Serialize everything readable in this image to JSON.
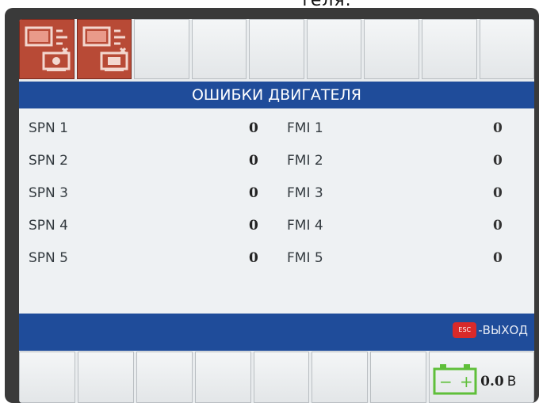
{
  "top_fragment": "теля.",
  "title": "ОШИБКИ ДВИГАТЕЛЯ",
  "rows": [
    {
      "spn_label": "SPN 1",
      "spn_value": "0",
      "fmi_label": "FMI 1",
      "fmi_value": "0"
    },
    {
      "spn_label": "SPN 2",
      "spn_value": "0",
      "fmi_label": "FMI 2",
      "fmi_value": "0"
    },
    {
      "spn_label": "SPN 3",
      "spn_value": "0",
      "fmi_label": "FMI 3",
      "fmi_value": "0"
    },
    {
      "spn_label": "SPN 4",
      "spn_value": "0",
      "fmi_label": "FMI 4",
      "fmi_value": "0"
    },
    {
      "spn_label": "SPN 5",
      "spn_value": "0",
      "fmi_label": "FMI 5",
      "fmi_value": "0"
    }
  ],
  "footer": {
    "esc_key": "ESC",
    "exit_label": "-ВЫХОД"
  },
  "battery": {
    "minus": "−",
    "plus": "+",
    "voltage": "0.0",
    "unit": "В"
  },
  "icons": {
    "slot1": "screen-settings-icon",
    "slot2": "screen-module-icon",
    "battery": "battery-icon"
  },
  "colors": {
    "title_bar": "#1f4c9a",
    "icon_button": "#b84a36",
    "esc_key": "#d92a2a",
    "battery": "#5fbf3a"
  }
}
